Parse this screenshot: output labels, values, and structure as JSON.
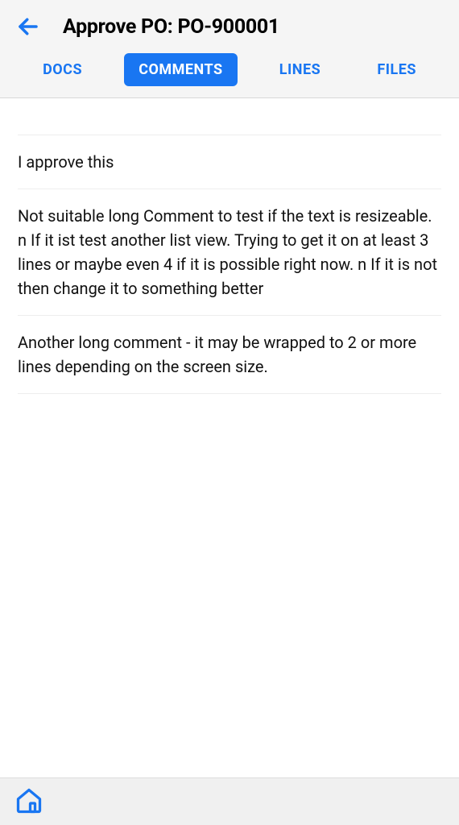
{
  "header": {
    "title": "Approve PO: PO-900001"
  },
  "tabs": [
    {
      "label": "DOCS",
      "active": false
    },
    {
      "label": "COMMENTS",
      "active": true
    },
    {
      "label": "LINES",
      "active": false
    },
    {
      "label": "FILES",
      "active": false
    }
  ],
  "comments": [
    {
      "text": "I approve this"
    },
    {
      "text": "Not suitable long Comment to test if the text is resizeable. n If it ist test another list view. Trying to get it on at least 3 lines or maybe even 4 if it is possible right now. n If it is not then change it to something better"
    },
    {
      "text": "Another long comment - it may be wrapped to 2 or more lines depending on the screen size."
    }
  ]
}
